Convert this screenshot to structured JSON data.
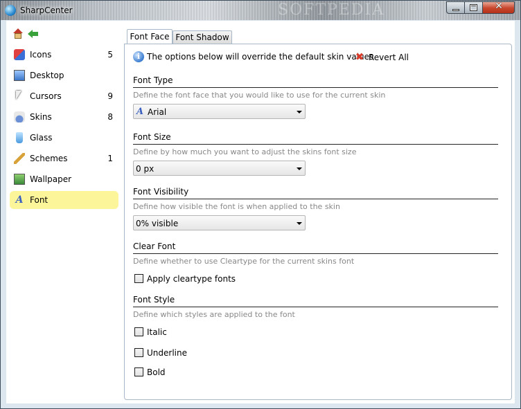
{
  "window": {
    "title": "SharpCenter",
    "watermark": "SOFTPEDIA",
    "caption_buttons": [
      "minimize",
      "maximize",
      "close"
    ]
  },
  "sidebar": {
    "top_icons": [
      "home-icon",
      "back-icon"
    ],
    "items": [
      {
        "label": "Icons",
        "count": "5",
        "icon": "icons-icon",
        "active": false
      },
      {
        "label": "Desktop",
        "count": "",
        "icon": "desktop-icon",
        "active": false
      },
      {
        "label": "Cursors",
        "count": "9",
        "icon": "cursor-icon",
        "active": false
      },
      {
        "label": "Skins",
        "count": "8",
        "icon": "skins-icon",
        "active": false
      },
      {
        "label": "Glass",
        "count": "",
        "icon": "glass-icon",
        "active": false
      },
      {
        "label": "Schemes",
        "count": "1",
        "icon": "schemes-icon",
        "active": false
      },
      {
        "label": "Wallpaper",
        "count": "",
        "icon": "wallpaper-icon",
        "active": false
      },
      {
        "label": "Font",
        "count": "",
        "icon": "font-icon",
        "active": true
      }
    ],
    "active_color": "#fdf59a"
  },
  "tabs": [
    {
      "label": "Font Face",
      "active": true
    },
    {
      "label": "Font Shadow",
      "active": false
    }
  ],
  "panel": {
    "info_text": "The options below will override the default skin values",
    "revert_label": "Revert All",
    "sections": [
      {
        "title": "Font Type",
        "description": "Define the font face that you would like to use for the current skin",
        "control": "select",
        "value": "Arial"
      },
      {
        "title": "Font Size",
        "description": "Define by how much you want to adjust the skins font size",
        "control": "select",
        "value": "0 px"
      },
      {
        "title": "Font Visibility",
        "description": "Define how visible the font is when applied to the skin",
        "control": "select",
        "value": "0% visible"
      },
      {
        "title": "Clear Font",
        "description": "Define whether to use Cleartype for the current skins font",
        "control": "checkbox",
        "options": [
          {
            "label": "Apply cleartype fonts",
            "checked": false
          }
        ]
      },
      {
        "title": "Font Style",
        "description": "Define which styles are applied to the font",
        "control": "checkbox",
        "options": [
          {
            "label": "Italic",
            "checked": false
          },
          {
            "label": "Underline",
            "checked": false
          },
          {
            "label": "Bold",
            "checked": false
          }
        ]
      }
    ]
  }
}
